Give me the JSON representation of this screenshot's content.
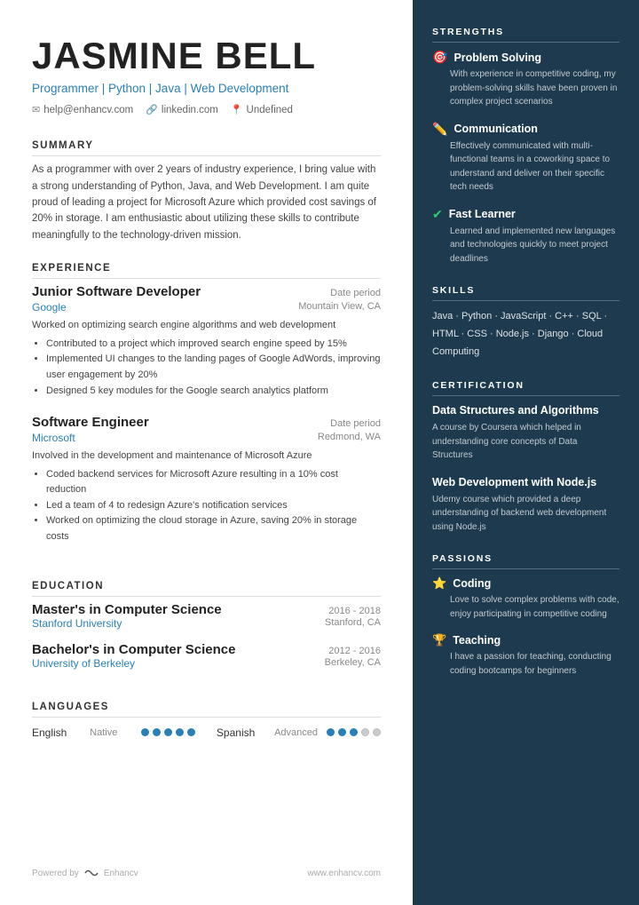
{
  "header": {
    "name": "JASMINE BELL",
    "title": "Programmer | Python | Java | Web Development",
    "email": "help@enhancv.com",
    "linkedin": "linkedin.com",
    "location": "Undefined"
  },
  "summary": {
    "section_title": "SUMMARY",
    "text": "As a programmer with over 2 years of industry experience, I bring value with a strong understanding of Python, Java, and Web Development. I am quite proud of leading a project for Microsoft Azure which provided cost savings of 20% in storage. I am enthusiastic about utilizing these skills to contribute meaningfully to the technology-driven mission."
  },
  "experience": {
    "section_title": "EXPERIENCE",
    "items": [
      {
        "role": "Junior Software Developer",
        "date": "Date period",
        "company": "Google",
        "location": "Mountain View, CA",
        "description": "Worked on optimizing search engine algorithms and web development",
        "bullets": [
          "Contributed to a project which improved search engine speed by 15%",
          "Implemented UI changes to the landing pages of Google AdWords, improving user engagement by 20%",
          "Designed 5 key modules for the Google search analytics platform"
        ]
      },
      {
        "role": "Software Engineer",
        "date": "Date period",
        "company": "Microsoft",
        "location": "Redmond, WA",
        "description": "Involved in the development and maintenance of Microsoft Azure",
        "bullets": [
          "Coded backend services for Microsoft Azure resulting in a 10% cost reduction",
          "Led a team of 4 to redesign Azure's notification services",
          "Worked on optimizing the cloud storage in Azure, saving 20% in storage costs"
        ]
      }
    ]
  },
  "education": {
    "section_title": "EDUCATION",
    "items": [
      {
        "degree": "Master's in Computer Science",
        "years": "2016 - 2018",
        "school": "Stanford University",
        "location": "Stanford, CA"
      },
      {
        "degree": "Bachelor's in Computer Science",
        "years": "2012 - 2016",
        "school": "University of Berkeley",
        "location": "Berkeley, CA"
      }
    ]
  },
  "languages": {
    "section_title": "LANGUAGES",
    "items": [
      {
        "name": "English",
        "level": "Native",
        "filled": 5,
        "total": 5
      },
      {
        "name": "Spanish",
        "level": "Advanced",
        "filled": 3,
        "total": 5
      }
    ]
  },
  "footer": {
    "powered_by": "Powered by",
    "brand": "Enhancv",
    "website": "www.enhancv.com"
  },
  "strengths": {
    "section_title": "STRENGTHS",
    "items": [
      {
        "icon": "🔴",
        "name": "Problem Solving",
        "desc": "With experience in competitive coding, my problem-solving skills have been proven in complex project scenarios"
      },
      {
        "icon": "✏️",
        "name": "Communication",
        "desc": "Effectively communicated with multi-functional teams in a coworking space to understand and deliver on their specific tech needs"
      },
      {
        "icon": "✔",
        "name": "Fast Learner",
        "desc": "Learned and implemented new languages and technologies quickly to meet project deadlines"
      }
    ]
  },
  "skills": {
    "section_title": "SKILLS",
    "text": "Java · Python · JavaScript · C++ · SQL · HTML · CSS · Node.js · Django · Cloud Computing"
  },
  "certification": {
    "section_title": "CERTIFICATION",
    "items": [
      {
        "name": "Data Structures and Algorithms",
        "desc": "A course by Coursera which helped in understanding core concepts of Data Structures"
      },
      {
        "name": "Web Development with Node.js",
        "desc": "Udemy course which provided a deep understanding of backend web development using Node.js"
      }
    ]
  },
  "passions": {
    "section_title": "PASSIONS",
    "items": [
      {
        "icon": "⭐",
        "name": "Coding",
        "desc": "Love to solve complex problems with code, enjoy participating in competitive coding"
      },
      {
        "icon": "🏆",
        "name": "Teaching",
        "desc": "I have a passion for teaching, conducting coding bootcamps for beginners"
      }
    ]
  }
}
